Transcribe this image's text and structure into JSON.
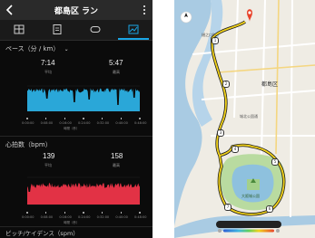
{
  "header": {
    "title": "都島区 ラン"
  },
  "tabs": [
    {
      "icon": "summary-icon",
      "active": false
    },
    {
      "icon": "document-icon",
      "active": false
    },
    {
      "icon": "laps-icon",
      "active": false
    },
    {
      "icon": "chart-icon",
      "active": true
    }
  ],
  "pace": {
    "title": "ペース（分 / km）",
    "avg_value": "7:14",
    "avg_label": "平均",
    "best_value": "5:47",
    "best_label": "最高",
    "x_ticks": [
      "0:00:00",
      "0:08:00",
      "0:16:00",
      "0:24:00",
      "0:32:00",
      "0:40:00",
      "0:48:00"
    ],
    "x_label": "時間（秒）",
    "color": "#2aa7d8"
  },
  "heart_rate": {
    "title": "心拍数（bpm）",
    "avg_value": "139",
    "avg_label": "平均",
    "max_value": "158",
    "max_label": "最高",
    "x_ticks": [
      "0:00:00",
      "0:08:00",
      "0:16:00",
      "0:24:00",
      "0:32:00",
      "0:40:00",
      "0:48:00"
    ],
    "x_label": "時間（秒）",
    "color": "#e23245"
  },
  "bottom_section": {
    "title": "ピッチ/ケイデンス（spm）"
  },
  "map": {
    "district_label": "都島区",
    "labels": [
      "樋之口町",
      "城北公園通",
      "大阪城公園"
    ],
    "markers": [
      "1",
      "2",
      "3",
      "4",
      "5",
      "6",
      "7"
    ],
    "route_color": "#f2d21a",
    "pin_color": "#e8432b"
  }
}
